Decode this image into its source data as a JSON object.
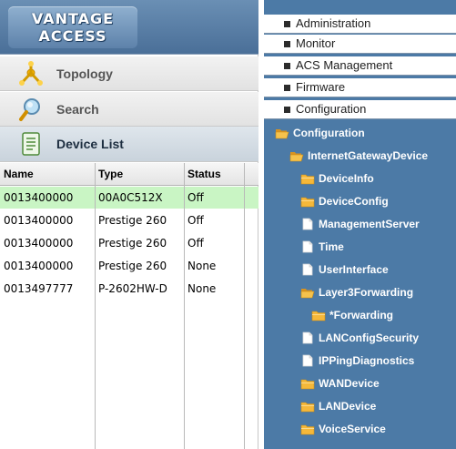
{
  "logo": {
    "line1": "VANTAGE",
    "line2": "ACCESS"
  },
  "nav": {
    "topology": "Topology",
    "search": "Search",
    "device_list": "Device List"
  },
  "device_table": {
    "columns": [
      "Name",
      "Type",
      "Status"
    ],
    "rows": [
      {
        "name": "0013400000",
        "type": "00A0C512X",
        "status": "Off",
        "selected": true
      },
      {
        "name": "0013400000",
        "type": "Prestige 260",
        "status": "Off",
        "selected": false
      },
      {
        "name": "0013400000",
        "type": "Prestige 260",
        "status": "Off",
        "selected": false
      },
      {
        "name": "0013400000",
        "type": "Prestige 260",
        "status": "None",
        "selected": false
      },
      {
        "name": "0013497777",
        "type": "P-2602HW-D",
        "status": "None",
        "selected": false
      }
    ]
  },
  "menu": {
    "items": [
      "Administration",
      "Monitor",
      "ACS  Management",
      "Firmware",
      "Configuration"
    ]
  },
  "tree": {
    "nodes": [
      {
        "label": "Configuration",
        "icon": "folder-open-icon"
      },
      {
        "label": "InternetGatewayDevice",
        "icon": "folder-open-icon"
      },
      {
        "label": "DeviceInfo",
        "icon": "folder-icon"
      },
      {
        "label": "DeviceConfig",
        "icon": "folder-icon"
      },
      {
        "label": "ManagementServer",
        "icon": "document-icon"
      },
      {
        "label": "Time",
        "icon": "document-icon"
      },
      {
        "label": "UserInterface",
        "icon": "document-icon"
      },
      {
        "label": "Layer3Forwarding",
        "icon": "folder-open-icon"
      },
      {
        "label": "*Forwarding",
        "icon": "folder-icon"
      },
      {
        "label": "LANConfigSecurity",
        "icon": "document-icon"
      },
      {
        "label": "IPPingDiagnostics",
        "icon": "document-icon"
      },
      {
        "label": "WANDevice",
        "icon": "folder-icon"
      },
      {
        "label": "LANDevice",
        "icon": "folder-icon"
      },
      {
        "label": "VoiceService",
        "icon": "folder-icon"
      }
    ]
  },
  "colors": {
    "panel_blue": "#4c7aa6",
    "selected_row": "#c9f5c4",
    "folder": "#f0b33a"
  }
}
